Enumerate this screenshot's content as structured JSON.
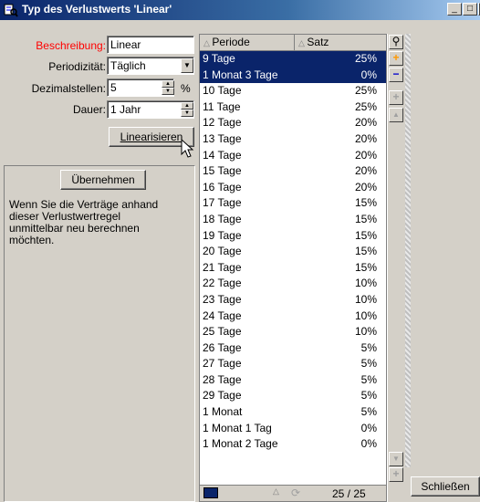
{
  "window": {
    "title": "Typ des Verlustwerts 'Linear'"
  },
  "form": {
    "beschreibung_label": "Beschreibung:",
    "beschreibung_value": "Linear",
    "periodizitaet_label": "Periodizität:",
    "periodizitaet_value": "Täglich",
    "dezimalstellen_label": "Dezimalstellen:",
    "dezimalstellen_value": "5",
    "dezimalstellen_unit": "%",
    "dauer_label": "Dauer:",
    "dauer_value": "1 Jahr",
    "linearisieren_label": "Linearisieren"
  },
  "info_panel": {
    "uebernehmen_label": "Übernehmen",
    "text": "Wenn Sie die Verträge anhand dieser Verlustwertregel unmittelbar neu berechnen möchten."
  },
  "list": {
    "columns": [
      "Periode",
      "Satz"
    ],
    "rows": [
      {
        "periode": "9 Tage",
        "satz": "25%",
        "selected": true
      },
      {
        "periode": "1 Monat 3 Tage",
        "satz": "0%",
        "selected": true
      },
      {
        "periode": "10 Tage",
        "satz": "25%"
      },
      {
        "periode": "11 Tage",
        "satz": "25%"
      },
      {
        "periode": "12 Tage",
        "satz": "20%"
      },
      {
        "periode": "13 Tage",
        "satz": "20%"
      },
      {
        "periode": "14 Tage",
        "satz": "20%"
      },
      {
        "periode": "15 Tage",
        "satz": "20%"
      },
      {
        "periode": "16 Tage",
        "satz": "20%"
      },
      {
        "periode": "17 Tage",
        "satz": "15%"
      },
      {
        "periode": "18 Tage",
        "satz": "15%"
      },
      {
        "periode": "19 Tage",
        "satz": "15%"
      },
      {
        "periode": "20 Tage",
        "satz": "15%"
      },
      {
        "periode": "21 Tage",
        "satz": "15%"
      },
      {
        "periode": "22 Tage",
        "satz": "10%"
      },
      {
        "periode": "23 Tage",
        "satz": "10%"
      },
      {
        "periode": "24 Tage",
        "satz": "10%"
      },
      {
        "periode": "25 Tage",
        "satz": "10%"
      },
      {
        "periode": "26 Tage",
        "satz": "5%"
      },
      {
        "periode": "27 Tage",
        "satz": "5%"
      },
      {
        "periode": "28 Tage",
        "satz": "5%"
      },
      {
        "periode": "29 Tage",
        "satz": "5%"
      },
      {
        "periode": "1 Monat",
        "satz": "5%"
      },
      {
        "periode": "1 Monat 1 Tag",
        "satz": "0%"
      },
      {
        "periode": "1 Monat 2 Tage",
        "satz": "0%"
      }
    ],
    "counter": "25 / 25"
  },
  "buttons": {
    "schliessen_label": "Schließen"
  },
  "colors": {
    "selection": "#0a246a",
    "title_bar": "#0a246a",
    "add_icon": "#ff9900",
    "remove_icon": "#0000cc",
    "required_label": "#ff0000"
  }
}
